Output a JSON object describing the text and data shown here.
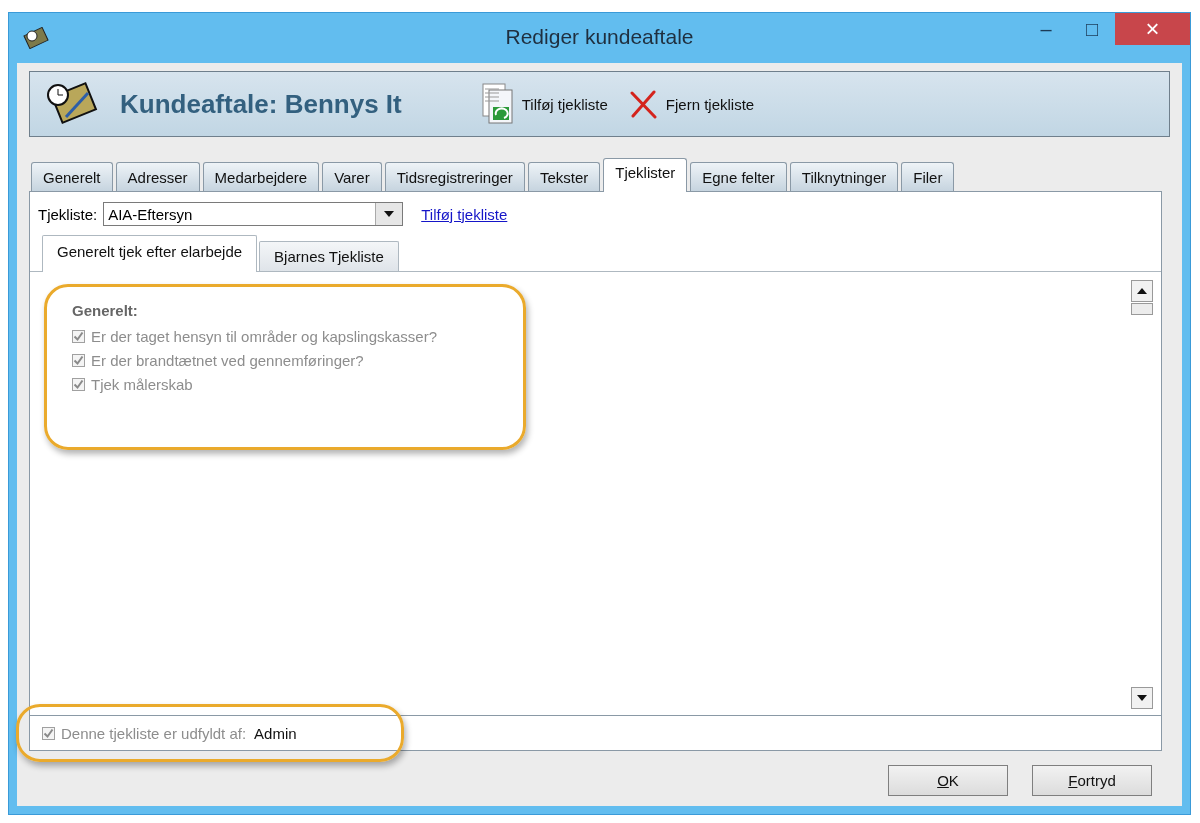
{
  "window": {
    "title": "Rediger kundeaftale",
    "controls": [
      "–",
      "□",
      "×"
    ]
  },
  "header": {
    "title": "Kundeaftale: Bennys It",
    "actions": [
      {
        "kind": "add",
        "label": "Tilføj tjekliste"
      },
      {
        "kind": "remove",
        "label": "Fjern tjekliste"
      }
    ]
  },
  "tabs": [
    {
      "label": "Generelt",
      "selected": false
    },
    {
      "label": "Adresser",
      "selected": false
    },
    {
      "label": "Medarbejdere",
      "selected": false
    },
    {
      "label": "Varer",
      "selected": false
    },
    {
      "label": "Tidsregistreringer",
      "selected": false
    },
    {
      "label": "Tekster",
      "selected": false
    },
    {
      "label": "Tjeklister",
      "selected": true
    },
    {
      "label": "Egne felter",
      "selected": false
    },
    {
      "label": "Tilknytninger",
      "selected": false
    },
    {
      "label": "Filer",
      "selected": false
    }
  ],
  "checklist_picker": {
    "label": "Tjekliste:",
    "value": "AIA-Eftersyn",
    "link": "Tilføj tjekliste"
  },
  "subtabs": [
    {
      "label": "Generelt tjek efter elarbejde",
      "selected": true
    },
    {
      "label": "Bjarnes Tjekliste",
      "selected": false
    }
  ],
  "section": {
    "heading": "Generelt:",
    "items": [
      {
        "label": "Er der taget hensyn til områder og kapslingskasser?",
        "checked": true,
        "disabled": true
      },
      {
        "label": "Er der  brandtætnet ved gennemføringer?",
        "checked": true,
        "disabled": true
      },
      {
        "label": "Tjek målerskab",
        "checked": true,
        "disabled": true
      }
    ]
  },
  "completed_by": {
    "label": "Denne tjekliste er udfyldt af:",
    "value": "Admin",
    "checked": true,
    "disabled": true
  },
  "buttons": [
    {
      "label": "OK"
    },
    {
      "label": "Fortryd"
    }
  ]
}
